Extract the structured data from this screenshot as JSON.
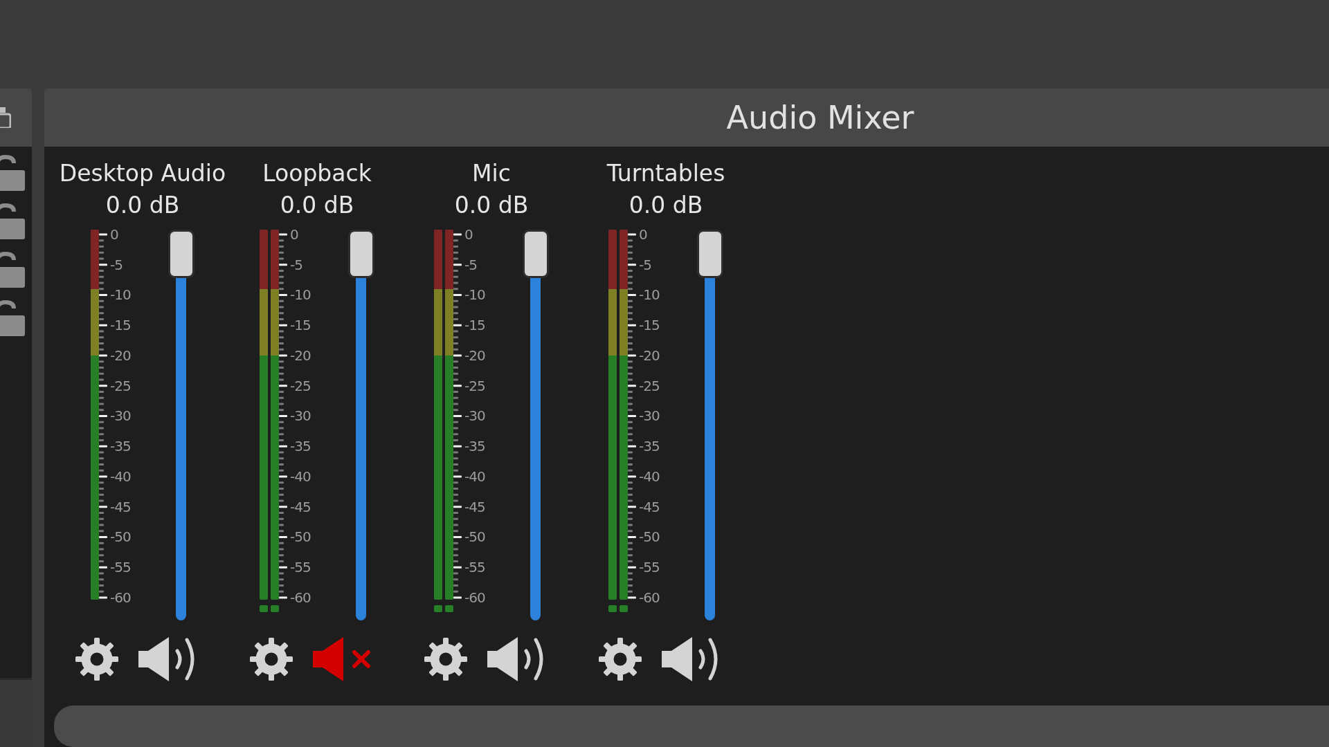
{
  "sidebar": {
    "locks": [
      {
        "locked": false
      },
      {
        "locked": false
      },
      {
        "locked": false
      },
      {
        "locked": false
      }
    ]
  },
  "mixer": {
    "title": "Audio Mixer",
    "channels": [
      {
        "name": "Desktop Audio",
        "volume": "0.0 dB",
        "kind": "mono",
        "level": 1.0,
        "muted": false,
        "scale": [
          "0",
          "-5",
          "-10",
          "-15",
          "-20",
          "-25",
          "-30",
          "-35",
          "-40",
          "-45",
          "-50",
          "-55",
          "-60"
        ]
      },
      {
        "name": "Loopback",
        "volume": "0.0 dB",
        "kind": "stereo",
        "level": 1.0,
        "muted": true,
        "scale": [
          "0",
          "-5",
          "-10",
          "-15",
          "-20",
          "-25",
          "-30",
          "-35",
          "-40",
          "-45",
          "-50",
          "-55",
          "-60"
        ]
      },
      {
        "name": "Mic",
        "volume": "0.0 dB",
        "kind": "stereo",
        "level": 1.0,
        "muted": false,
        "scale": [
          "0",
          "-5",
          "-10",
          "-15",
          "-20",
          "-25",
          "-30",
          "-35",
          "-40",
          "-45",
          "-50",
          "-55",
          "-60"
        ]
      },
      {
        "name": "Turntables",
        "volume": "0.0 dB",
        "kind": "stereo",
        "level": 1.0,
        "muted": false,
        "scale": [
          "0",
          "-5",
          "-10",
          "-15",
          "-20",
          "-25",
          "-30",
          "-35",
          "-40",
          "-45",
          "-50",
          "-55",
          "-60"
        ]
      }
    ]
  }
}
